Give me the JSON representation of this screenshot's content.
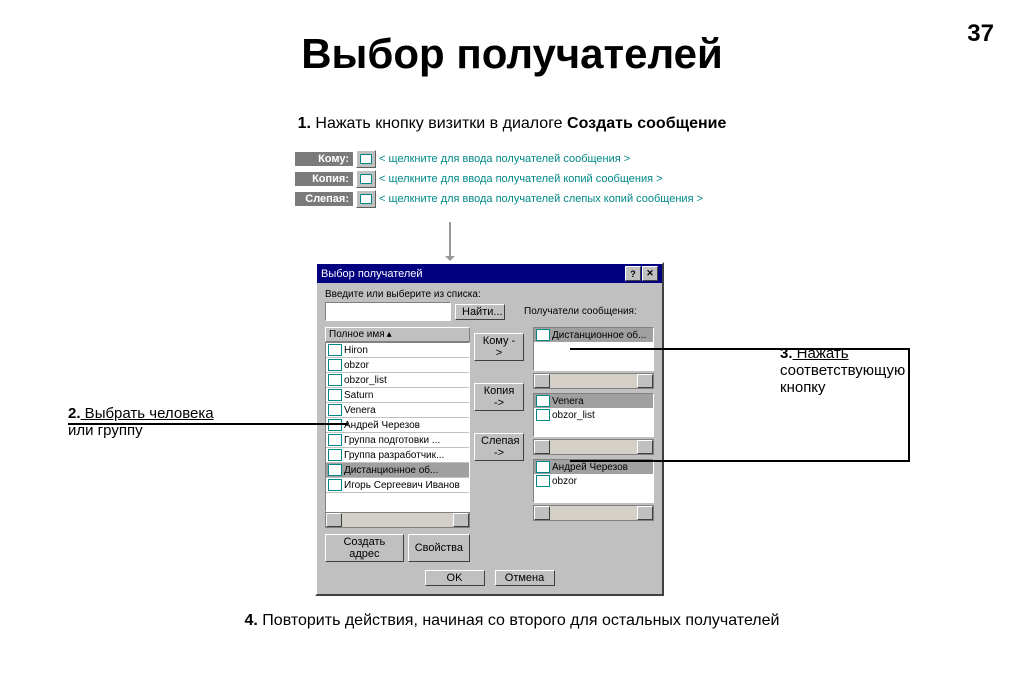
{
  "page_number": "37",
  "title": "Выбор получателей",
  "step1_prefix": "1.",
  "step1_text": " Нажать кнопку визитки в диалоге ",
  "step1_bold": "Создать сообщение",
  "step4_prefix": "4.",
  "step4_text": " Повторить действия, начиная со второго для остальных получателей",
  "fields": [
    {
      "label": "Кому:",
      "placeholder": "< щелкните для ввода получателей сообщения >"
    },
    {
      "label": "Копия:",
      "placeholder": "< щелкните для ввода получателей копий сообщения >"
    },
    {
      "label": "Слепая:",
      "placeholder": "< щелкните для ввода получателей слепых копий сообщения >"
    }
  ],
  "dialog": {
    "title": "Выбор получателей",
    "search_label": "Введите или выберите из списка:",
    "find": "Найти...",
    "col_header": "Полное имя",
    "recipients_label": "Получатели сообщения:",
    "items": [
      "Hiron",
      "obzor",
      "obzor_list",
      "Saturn",
      "Venera",
      "Андрей Черезов",
      "Группа подготовки ...",
      "Группа разработчик...",
      "Дистанционное об...",
      "Игорь Сергеевич Иванов"
    ],
    "btn_to": "Кому ->",
    "btn_cc": "Копия ->",
    "btn_bcc": "Слепая ->",
    "create_addr": "Создать адрес",
    "properties": "Свойства",
    "ok": "OK",
    "cancel": "Отмена",
    "box_to": [
      "Дистанционное об..."
    ],
    "box_cc": [
      "Venera",
      "obzor_list"
    ],
    "box_bcc": [
      "Андрей Черезов",
      "obzor"
    ]
  },
  "ann2_prefix": "2.",
  "ann2_u": " Выбрать человека",
  "ann2_rest": "или группу",
  "ann3_prefix": "3.",
  "ann3_u": " Нажать",
  "ann3_l2": "соответствующую",
  "ann3_l3": "кнопку"
}
